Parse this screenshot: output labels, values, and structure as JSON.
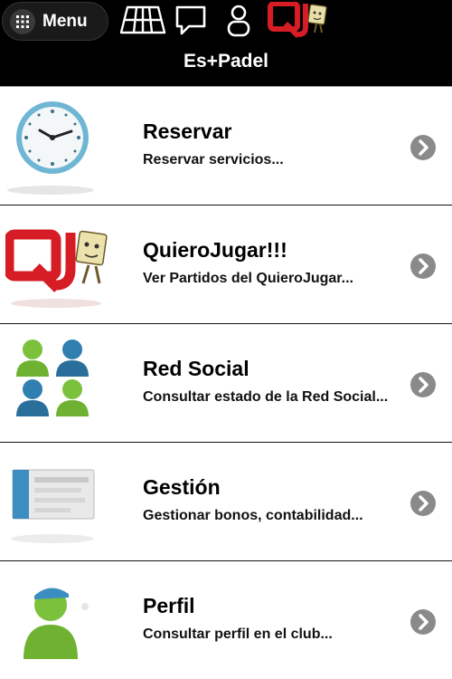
{
  "header": {
    "menu_label": "Menu",
    "app_title": "Es+Padel",
    "icons": [
      "grid-icon",
      "court-icon",
      "chat-bubble-icon",
      "user-icon",
      "quierojugar-logo-icon"
    ]
  },
  "colors": {
    "topbar": "#000000",
    "arrow": "#8a8a8a",
    "brand_red": "#d61c24"
  },
  "menu_items": [
    {
      "title": "Reservar",
      "subtitle": "Reservar servicios...",
      "icon": "clock-icon"
    },
    {
      "title": "QuieroJugar!!!",
      "subtitle": "Ver Partidos del QuieroJugar...",
      "icon": "quierojugar-logo-icon"
    },
    {
      "title": "Red Social",
      "subtitle": "Consultar estado de la Red Social...",
      "icon": "people-group-icon"
    },
    {
      "title": "Gestión",
      "subtitle": "Gestionar bonos, contabilidad...",
      "icon": "document-card-icon"
    },
    {
      "title": "Perfil",
      "subtitle": "Consultar perfil en el club...",
      "icon": "profile-user-icon"
    }
  ]
}
